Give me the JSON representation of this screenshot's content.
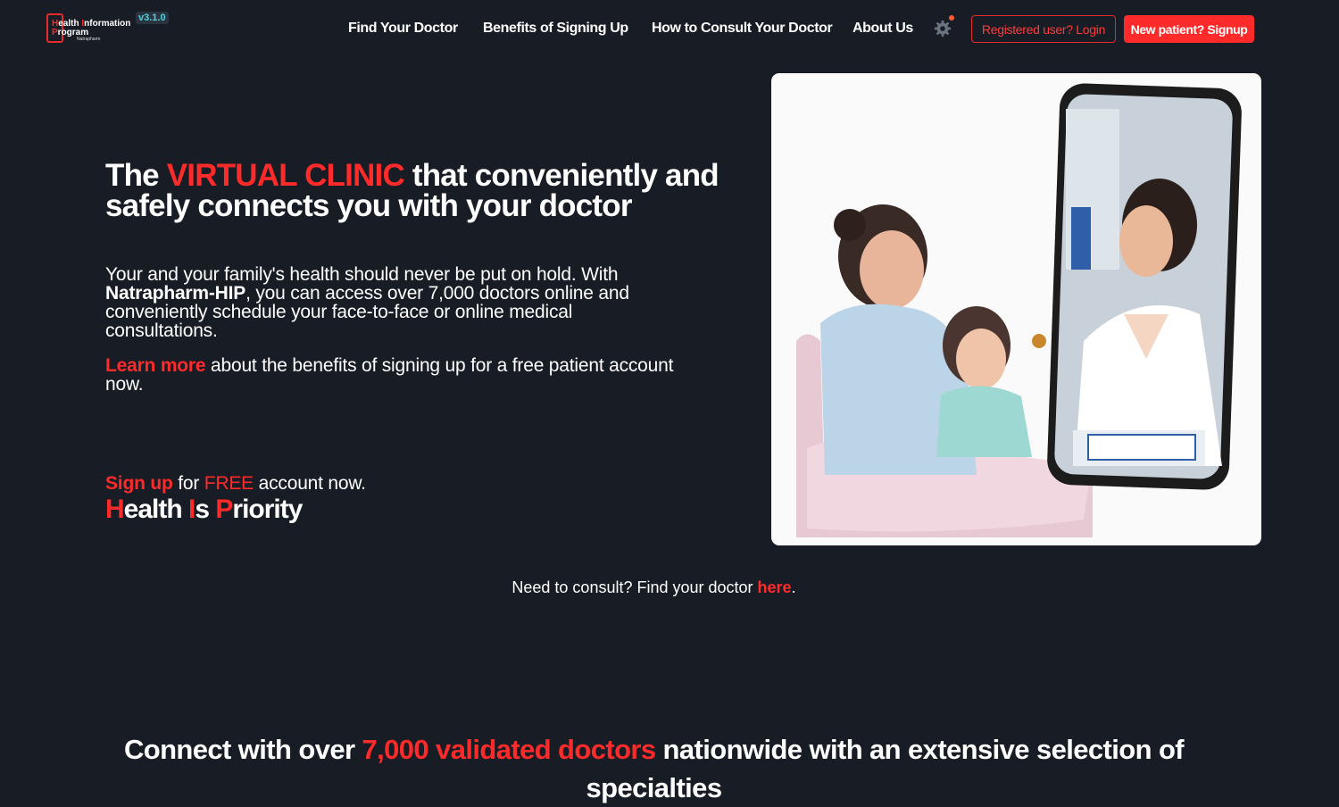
{
  "header": {
    "logo": {
      "line1_prefix": "H",
      "line1_rest": "ealth ",
      "line1_i": "I",
      "line1_end": "nformation",
      "line2_prefix": "P",
      "line2_rest": "rogram",
      "company": "Natrapharm",
      "version": "v3.1.0"
    },
    "nav": [
      "Find Your Doctor",
      "Benefits of Signing Up",
      "How to Consult Your Doctor",
      "About Us"
    ],
    "settings_icon": "gear-icon",
    "login_label": "Registered user? Login",
    "signup_label": "New patient? Signup"
  },
  "hero": {
    "title_the": "The ",
    "title_highlight": "VIRTUAL CLINIC",
    "title_rest": " that conveniently and safely connects you with your doctor",
    "p1_start": "Your and your family's health should never be put on hold. With ",
    "p1_brand": "Natrapharm-HIP",
    "p1_end": ", you can access over 7,000 doctors online and conveniently schedule your face-to-face or online medical consultations.",
    "p2_link": "Learn more",
    "p2_rest": " about the benefits of signing up for a free patient account now.",
    "p3_link": "Sign up",
    "p3_for": " for ",
    "p3_free": "FREE",
    "p3_rest": " account now.",
    "motto": [
      {
        "cap": "H",
        "rest": "ealth "
      },
      {
        "cap": "I",
        "rest": "s "
      },
      {
        "cap": "P",
        "rest": "riority"
      }
    ]
  },
  "consult": {
    "text": "Need to consult? Find your doctor ",
    "link": "here",
    "end": "."
  },
  "connect": {
    "start": "Connect with over ",
    "highlight": "7,000 validated doctors",
    "end": " nationwide with an extensive selection of specialties"
  },
  "colors": {
    "background": "#181c24",
    "accent": "#ff2a2a",
    "text": "#ffffff",
    "version_badge": "#4fd1d9"
  }
}
